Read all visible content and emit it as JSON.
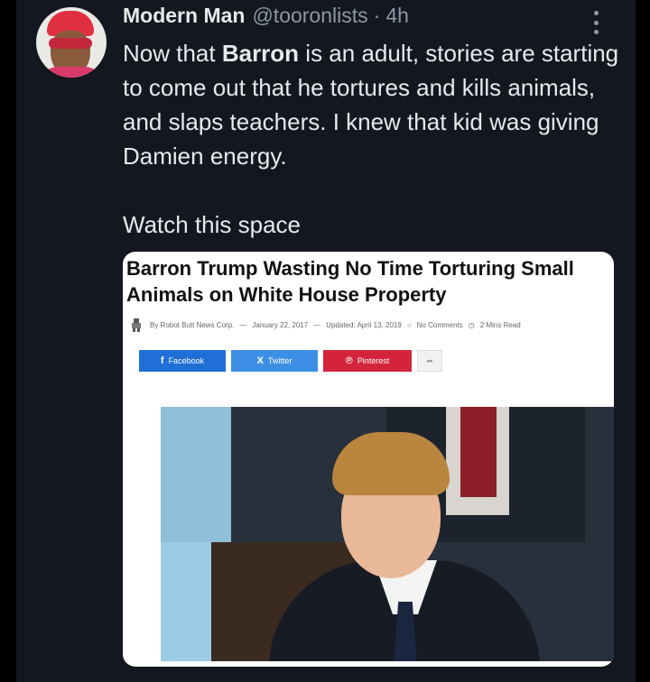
{
  "tweet": {
    "author_name": "Modern Man",
    "handle": "@tooronlists",
    "separator": "·",
    "time": "4h",
    "text_before_bold": "Now that ",
    "text_bold": "Barron",
    "text_after_bold": " is an adult, stories are starting to come out that he tortures and kills animals, and slaps teachers. I knew that kid was giving Damien energy.",
    "watch_text": "Watch this space"
  },
  "article": {
    "title_line1": "Barron Trump Wasting No Time Torturing Small",
    "title_line2": "Animals on White House Property",
    "author": "By Robot Butt News Corp.",
    "date_sep1": "—",
    "date": "January 22, 2017",
    "date_sep2": "—",
    "updated": "Updated: April 13, 2019",
    "comments": "No Comments",
    "read_time": "2 Mins Read",
    "share": {
      "facebook_label": "Facebook",
      "twitter_label": "Twitter",
      "pinterest_label": "Pinterest",
      "facebook_icon": "f",
      "twitter_icon": "X",
      "pinterest_icon": "℗",
      "share_icon": "➦"
    }
  },
  "colors": {
    "background": "#14171f",
    "facebook": "#1f6fd6",
    "twitter": "#3c8fe4",
    "pinterest": "#d3243c"
  }
}
